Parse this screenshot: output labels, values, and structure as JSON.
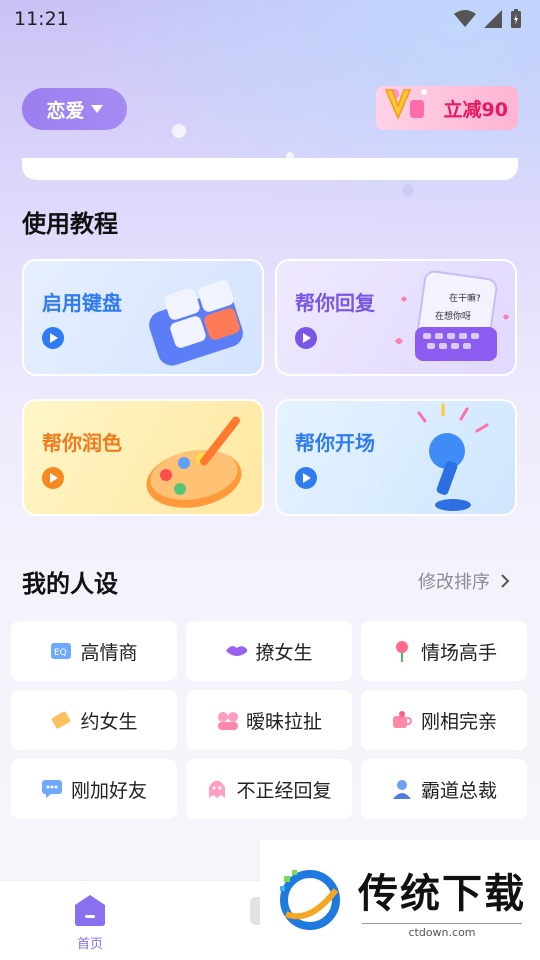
{
  "status_bar": {
    "time": "11:21"
  },
  "header": {
    "mode_label": "恋爱",
    "vip_promo": "立减90"
  },
  "tutorial": {
    "title": "使用教程",
    "cards": [
      {
        "label": "启用键盘",
        "accent": "#2f7bf1"
      },
      {
        "label": "帮你回复",
        "accent": "#7a56e6"
      },
      {
        "label": "帮你润色",
        "accent": "#f07a1e"
      },
      {
        "label": "帮你开场",
        "accent": "#2f7bf1"
      }
    ],
    "reply_art_bubbles": [
      "在干嘛?",
      "在想你呀"
    ]
  },
  "personas": {
    "title": "我的人设",
    "edit_label": "修改排序",
    "items": [
      {
        "label": "高情商",
        "icon": "eq-icon"
      },
      {
        "label": "撩女生",
        "icon": "lips-icon"
      },
      {
        "label": "情场高手",
        "icon": "rose-icon"
      },
      {
        "label": "约女生",
        "icon": "ticket-icon"
      },
      {
        "label": "暧昧拉扯",
        "icon": "couple-icon"
      },
      {
        "label": "刚相完亲",
        "icon": "cup-icon"
      },
      {
        "label": "刚加好友",
        "icon": "chat-icon"
      },
      {
        "label": "不正经回复",
        "icon": "ghost-icon"
      },
      {
        "label": "霸道总裁",
        "icon": "boss-icon"
      }
    ]
  },
  "tabbar": {
    "home_label": "首页"
  },
  "watermark": {
    "title": "传统下载",
    "url": "ctdown.com"
  }
}
